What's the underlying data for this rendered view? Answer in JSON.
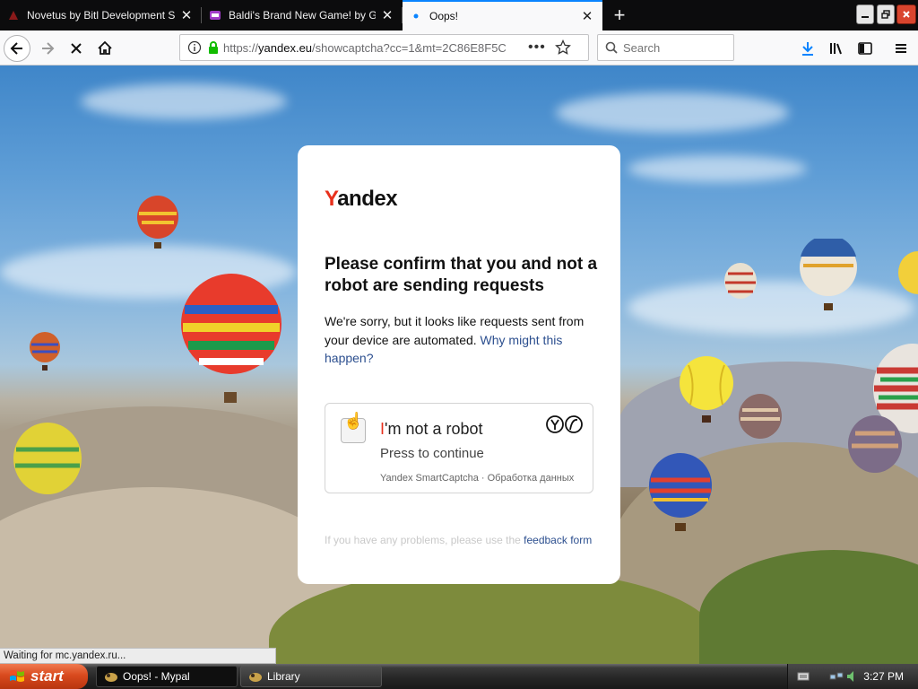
{
  "tabs": [
    {
      "title": "Novetus by Bitl Development Studio"
    },
    {
      "title": "Baldi's Brand New Game! by Grand"
    },
    {
      "title": "Oops!"
    }
  ],
  "navbar": {
    "url_prefix": "https://",
    "url_host": "yandex.eu",
    "url_path": "/showcaptcha?cc=1&mt=2C86E8F5C",
    "search_placeholder": "Search"
  },
  "captcha_page": {
    "logo_first": "Y",
    "logo_rest": "andex",
    "headline": "Please confirm that you and not a robot are sending requests",
    "desc": "We're sorry, but it looks like requests sent from your device are automated.",
    "desc_link": "Why might this happen?",
    "widget": {
      "label_first": "I",
      "label_rest": "'m not a robot",
      "press": "Press to continue",
      "footer": "Yandex SmartCaptcha · Обработка данных"
    },
    "problems": "If you have any problems, please use the",
    "problems_link": "feedback form"
  },
  "status_text": "Waiting for mc.yandex.ru...",
  "taskbar": {
    "start": "start",
    "items": [
      {
        "label": "Oops! - Mypal"
      },
      {
        "label": "Library"
      }
    ],
    "clock": "3:27 PM"
  },
  "colors": {
    "brand_red": "#e8301c",
    "link_blue": "#2c4f8f",
    "tab_accent": "#0a84ff"
  }
}
